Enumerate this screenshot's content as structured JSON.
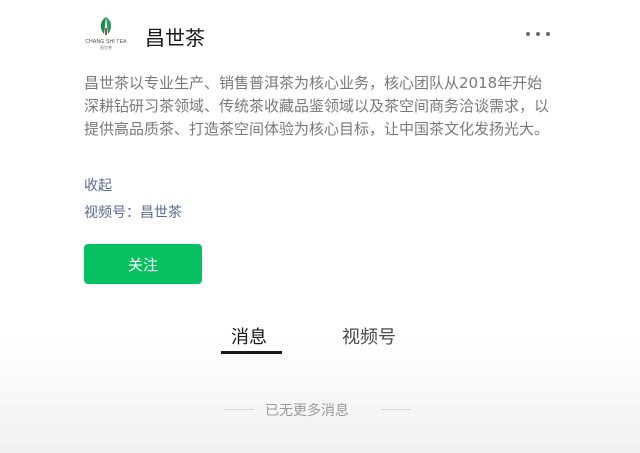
{
  "account": {
    "name": "昌世茶",
    "logo_text": "CHANG SHI TEA",
    "logo_subtext": "昌世茶"
  },
  "description": "昌世茶以专业生产、销售普洱茶为核心业务，核心团队从2018年开始深耕钻研习茶领域、传统茶收藏品鉴领域以及茶空间商务洽谈需求，以提供高品质茶、打造茶空间体验为核心目标，让中国茶文化发扬光大。",
  "collapse_label": "收起",
  "channels": {
    "label": "视频号",
    "separator": "：",
    "value": "昌世茶"
  },
  "follow_button_label": "关注",
  "tabs": [
    {
      "label": "消息",
      "active": true
    },
    {
      "label": "视频号",
      "active": false
    }
  ],
  "end_text": "已无更多消息",
  "colors": {
    "accent_green": "#07c160",
    "link_blue": "#576b95",
    "logo_green": "#1f8a4c"
  },
  "icons": {
    "more": "more-icon"
  }
}
